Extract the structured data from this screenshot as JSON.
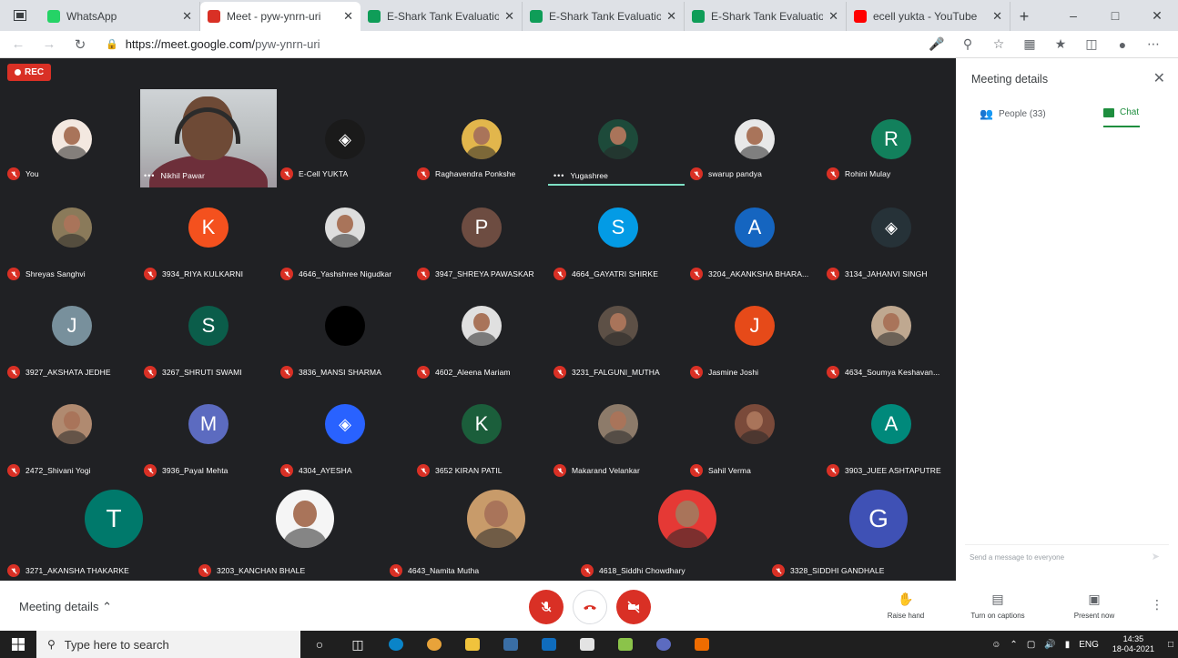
{
  "browser": {
    "tabs": [
      {
        "label": "WhatsApp",
        "favicon_color": "#25d366",
        "active": false
      },
      {
        "label": "Meet - pyw-ynrn-uri",
        "favicon_color": "#d93025",
        "active": true
      },
      {
        "label": "E-Shark Tank Evaluation Sh",
        "favicon_color": "#0f9d58",
        "active": false
      },
      {
        "label": "E-Shark Tank Evaluation Sh",
        "favicon_color": "#0f9d58",
        "active": false
      },
      {
        "label": "E-Shark Tank Evaluation Sh",
        "favicon_color": "#0f9d58",
        "active": false
      },
      {
        "label": "ecell yukta - YouTube",
        "favicon_color": "#ff0000",
        "active": false
      }
    ],
    "url_host": "https://meet.google.com/",
    "url_path": "pyw-ynrn-uri"
  },
  "meet": {
    "rec_label": "REC",
    "participants": [
      {
        "name": "You",
        "initial": "",
        "color": "#f3e8e0",
        "kind": "photo"
      },
      {
        "name": "Nikhil Pawar",
        "initial": "",
        "color": "",
        "kind": "video"
      },
      {
        "name": "E-Cell YUKTA",
        "initial": "",
        "color": "#1a1a1a",
        "kind": "logo"
      },
      {
        "name": "Raghavendra Ponkshe",
        "initial": "",
        "color": "#e2b64c",
        "kind": "photo"
      },
      {
        "name": "Yugashree",
        "initial": "",
        "color": "#1d4a3a",
        "kind": "photo"
      },
      {
        "name": "swarup pandya",
        "initial": "",
        "color": "#e8e8e8",
        "kind": "photo"
      },
      {
        "name": "Rohini Mulay",
        "initial": "R",
        "color": "#12805c",
        "kind": "initial"
      },
      {
        "name": "Shreyas Sanghvi",
        "initial": "",
        "color": "#8a7a5a",
        "kind": "photo"
      },
      {
        "name": "3934_RIYA KULKARNI",
        "initial": "K",
        "color": "#f4511e",
        "kind": "initial"
      },
      {
        "name": "4646_Yashshree Nigudkar",
        "initial": "",
        "color": "#ddd",
        "kind": "photo"
      },
      {
        "name": "3947_SHREYA PAWASKAR",
        "initial": "P",
        "color": "#6d4c41",
        "kind": "initial"
      },
      {
        "name": "4664_GAYATRI SHIRKE",
        "initial": "S",
        "color": "#039be5",
        "kind": "initial"
      },
      {
        "name": "3204_AKANKSHA BHARA...",
        "initial": "A",
        "color": "#1565c0",
        "kind": "initial"
      },
      {
        "name": "3134_JAHANVI SINGH",
        "initial": "",
        "color": "#263238",
        "kind": "logo"
      },
      {
        "name": "3927_AKSHATA JEDHE",
        "initial": "J",
        "color": "#78909c",
        "kind": "initial"
      },
      {
        "name": "3267_SHRUTI SWAMI",
        "initial": "S",
        "color": "#0b5d4a",
        "kind": "initial"
      },
      {
        "name": "3836_MANSI SHARMA",
        "initial": "",
        "color": "#000000",
        "kind": "photo"
      },
      {
        "name": "4602_Aleena Mariam",
        "initial": "",
        "color": "#e0e0e0",
        "kind": "photo"
      },
      {
        "name": "3231_FALGUNI_MUTHA",
        "initial": "",
        "color": "#5d5046",
        "kind": "photo"
      },
      {
        "name": "Jasmine Joshi",
        "initial": "J",
        "color": "#e64a19",
        "kind": "initial"
      },
      {
        "name": "4634_Soumya Keshavan...",
        "initial": "",
        "color": "#bfa890",
        "kind": "photo"
      },
      {
        "name": "2472_Shivani Yogi",
        "initial": "",
        "color": "#b08a70",
        "kind": "photo"
      },
      {
        "name": "3936_Payal Mehta",
        "initial": "M",
        "color": "#5c6bc0",
        "kind": "initial"
      },
      {
        "name": "4304_AYESHA",
        "initial": "",
        "color": "#2962ff",
        "kind": "logo"
      },
      {
        "name": "3652 KIRAN PATIL",
        "initial": "K",
        "color": "#1b5e3b",
        "kind": "initial"
      },
      {
        "name": "Makarand Velankar",
        "initial": "",
        "color": "#8d7b6a",
        "kind": "photo"
      },
      {
        "name": "Sahil Verma",
        "initial": "",
        "color": "#7a4a3a",
        "kind": "photo"
      },
      {
        "name": "3903_JUEE ASHTAPUTRE",
        "initial": "A",
        "color": "#00897b",
        "kind": "initial"
      },
      {
        "name": "3271_AKANSHA THAKARKE",
        "initial": "T",
        "color": "#00796b",
        "kind": "initial"
      },
      {
        "name": "3203_KANCHAN BHALE",
        "initial": "",
        "color": "#f5f5f5",
        "kind": "photo"
      },
      {
        "name": "4643_Namita Mutha",
        "initial": "",
        "color": "#c89b6a",
        "kind": "photo"
      },
      {
        "name": "4618_Siddhi Chowdhary",
        "initial": "",
        "color": "#e53935",
        "kind": "photo"
      },
      {
        "name": "3328_SIDDHI GANDHALE",
        "initial": "G",
        "color": "#3f51b5",
        "kind": "initial"
      }
    ]
  },
  "panel": {
    "title": "Meeting details",
    "tab_people": "People (33)",
    "tab_chat": "Chat",
    "chat_placeholder": "Send a message to everyone"
  },
  "bottom": {
    "meeting_details": "Meeting details",
    "raise_hand": "Raise hand",
    "captions": "Turn on captions",
    "present": "Present now"
  },
  "taskbar": {
    "search_placeholder": "Type here to search",
    "lang": "ENG",
    "time": "14:35",
    "date": "18-04-2021"
  }
}
